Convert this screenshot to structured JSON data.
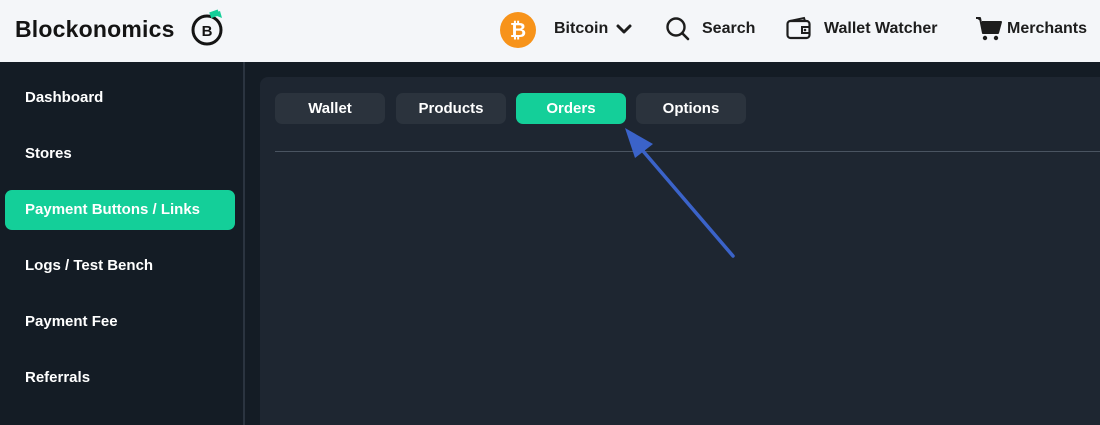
{
  "header": {
    "brand": "Blockonomics",
    "brand_badge": "B",
    "coin_symbol": "₿",
    "nav": {
      "bitcoin": "Bitcoin",
      "search": "Search",
      "wallet_watcher": "Wallet Watcher",
      "merchants": "Merchants"
    }
  },
  "sidebar": {
    "items": [
      {
        "label": "Dashboard"
      },
      {
        "label": "Stores"
      },
      {
        "label": "Payment Buttons / Links",
        "active": true
      },
      {
        "label": "Logs / Test Bench"
      },
      {
        "label": "Payment Fee"
      },
      {
        "label": "Referrals"
      }
    ]
  },
  "main": {
    "tabs": [
      {
        "label": "Wallet"
      },
      {
        "label": "Products"
      },
      {
        "label": "Orders",
        "active": true
      },
      {
        "label": "Options"
      }
    ]
  },
  "colors": {
    "accent": "#14cf99",
    "header_bg": "#f4f6f9",
    "sidebar_bg": "#141c25",
    "main_bg": "#1e2631",
    "tab_bg": "#2b333d",
    "bitcoin_orange": "#f7931a",
    "annotation_arrow": "#3b63c9"
  },
  "icons": {
    "bitcoin": "bitcoin-coin-icon",
    "bitcoin_dropdown": "chevron-down-icon",
    "search": "search-icon",
    "wallet": "wallet-icon",
    "merchants": "shopping-cart-icon",
    "logo": "blockonomics-logo-icon"
  }
}
